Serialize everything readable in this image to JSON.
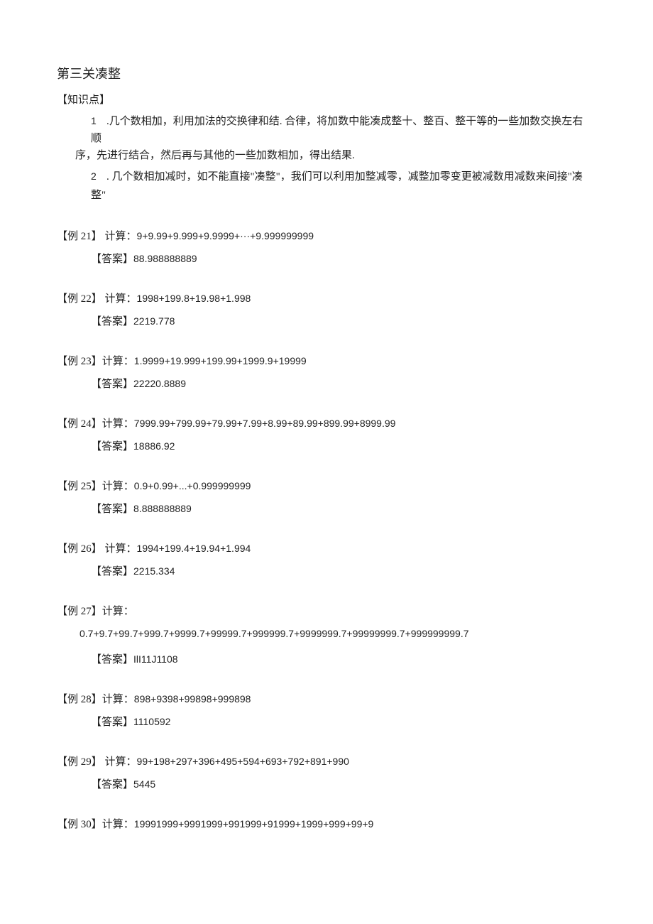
{
  "title": "第三关凑整",
  "knowledge_label": "【知识点】",
  "knowledge": [
    {
      "num": "1",
      "text_a": ".几个数相加，利用加法的交换律和结. 合律，将加数中能凑成整十、整百、整干等的一些加数交换左右顺",
      "text_b": "序，先进行结合，然后再与其他的一些加数相加，得出结果."
    },
    {
      "num": "2",
      "text_a": ". 几个数相加减时，如不能直接\"凑整\"，我们可以利用加整减零，减整加零变更被减数用减数来间接\"凑",
      "text_b": "整\""
    }
  ],
  "examples": [
    {
      "label": "【例 21】",
      "prefix": " 计算：",
      "expr": "9+9.99+9.999+9.9999+···+9.999999999",
      "answer_label": "【答案】",
      "answer": "88.988888889"
    },
    {
      "label": "【例 22】",
      "prefix": " 计算：",
      "expr": "1998+199.8+19.98+1.998",
      "answer_label": "【答案】",
      "answer": "2219.778"
    },
    {
      "label": "【例 23】",
      "prefix": "计算：",
      "expr": "1.9999+19.999+199.99+1999.9+19999",
      "answer_label": "【答案】",
      "answer": "22220.8889"
    },
    {
      "label": "【例 24】",
      "prefix": "计算：",
      "expr": "7999.99+799.99+79.99+7.99+8.99+89.99+899.99+8999.99",
      "answer_label": "【答案】",
      "answer": "18886.92"
    },
    {
      "label": "【例 25】",
      "prefix": "计算：",
      "expr": "0.9+0.99+...+0.999999999",
      "answer_label": "【答案】",
      "answer": "8.888888889"
    },
    {
      "label": "【例 26】",
      "prefix": " 计算：",
      "expr": "1994+199.4+19.94+1.994",
      "answer_label": "【答案】",
      "answer": "2215.334"
    },
    {
      "label": "【例 27】",
      "prefix": "计算：",
      "expr": "",
      "sub_expr": "0.7+9.7+99.7+999.7+9999.7+99999.7+999999.7+9999999.7+99999999.7+999999999.7",
      "answer_label": "【答案】",
      "answer": "IlI11J1108"
    },
    {
      "label": "【例 28】",
      "prefix": "计算：",
      "expr": "898+9398+99898+999898",
      "answer_label": "【答案】",
      "answer": "1110592"
    },
    {
      "label": "【例 29】",
      "prefix": " 计算：",
      "expr": "99+198+297+396+495+594+693+792+891+990",
      "answer_label": "【答案】",
      "answer": "5445"
    },
    {
      "label": "【例 30】",
      "prefix": "计算：",
      "expr": "19991999+9991999+991999+91999+1999+999+99+9",
      "answer_label": "",
      "answer": ""
    }
  ]
}
